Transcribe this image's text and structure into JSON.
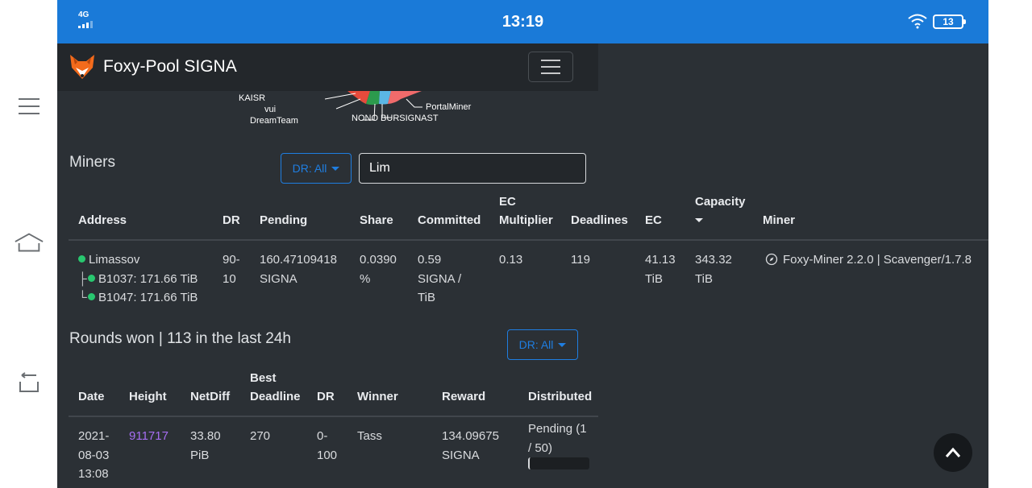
{
  "status_bar": {
    "network": "4G",
    "time": "13:19",
    "battery": "13"
  },
  "navbar": {
    "brand": "Foxy-Pool SIGNA"
  },
  "pie_labels": {
    "kaisr": "KAISR",
    "vui": "vui",
    "dreamteam": "DreamTeam",
    "portalminer": "PortalMiner",
    "nono": "NONO BURSIGNAST"
  },
  "miners": {
    "title": "Miners",
    "dr_filter": "DR: All",
    "search_value": "Lim",
    "headers": {
      "address": "Address",
      "dr": "DR",
      "pending": "Pending",
      "share": "Share",
      "committed": "Committed",
      "ec_multiplier_1": "EC",
      "ec_multiplier_2": "Multiplier",
      "deadlines": "Deadlines",
      "ec": "EC",
      "capacity": "Capacity",
      "miner": "Miner"
    },
    "row": {
      "name": "Limassov",
      "sub1": "B1037: 171.66 TiB",
      "sub2": "B1047: 171.66 TiB",
      "dr_1": "90-",
      "dr_2": "10",
      "pending_1": "160.47109418",
      "pending_2": "SIGNA",
      "share_1": "0.0390",
      "share_2": "%",
      "committed_1": "0.59",
      "committed_2": "SIGNA /",
      "committed_3": "TiB",
      "ec_multiplier": "0.13",
      "deadlines": "119",
      "ec_1": "41.13",
      "ec_2": "TiB",
      "capacity_1": "343.32",
      "capacity_2": "TiB",
      "miner": "Foxy-Miner 2.2.0 | Scavenger/1.7.8"
    }
  },
  "rounds": {
    "title": "Rounds won | 113 in the last 24h",
    "dr_filter": "DR: All",
    "headers": {
      "date": "Date",
      "height": "Height",
      "netdiff": "NetDiff",
      "best_1": "Best",
      "best_2": "Deadline",
      "dr": "DR",
      "winner": "Winner",
      "reward": "Reward",
      "distributed": "Distributed"
    },
    "row": {
      "date_1": "2021-",
      "date_2": "08-03",
      "date_3": "13:08",
      "height": "911717",
      "netdiff_1": "33.80",
      "netdiff_2": "PiB",
      "best_deadline": "270",
      "dr_1": "0-",
      "dr_2": "100",
      "winner": "Tass",
      "reward_1": "134.09675",
      "reward_2": "SIGNA",
      "distributed_1": "Pending (1",
      "distributed_2": "/ 50)"
    }
  },
  "colors": {
    "status_bar": "#1a7ad8",
    "page_bg": "#2b3035",
    "navbar_bg": "#23272b",
    "accent": "#1f7ee1",
    "online": "#28c76f",
    "link": "#a66ef2"
  }
}
